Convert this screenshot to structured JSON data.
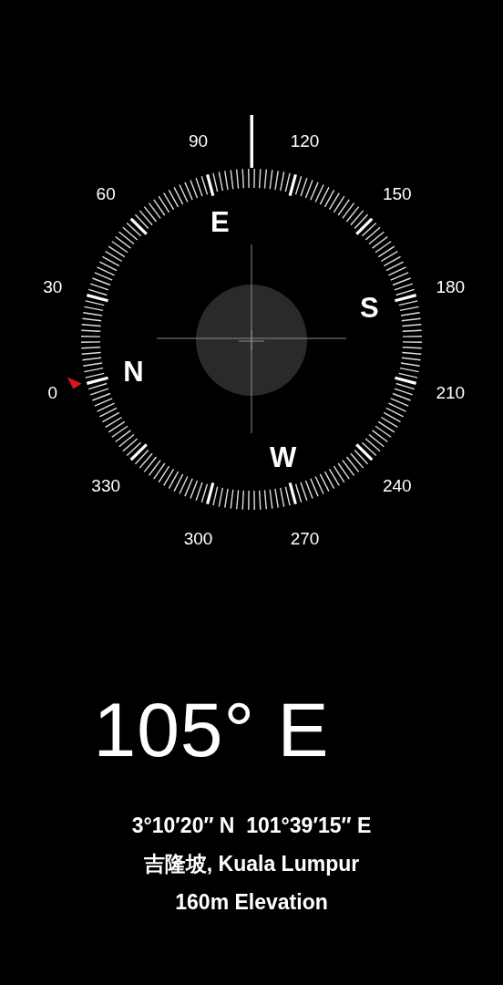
{
  "dial_labels": [
    "0",
    "30",
    "60",
    "90",
    "120",
    "150",
    "180",
    "210",
    "240",
    "270",
    "300",
    "330"
  ],
  "cardinals": [
    "N",
    "E",
    "S",
    "W"
  ],
  "heading": "105° E",
  "coordinates": "3°10′20″ N  101°39′15″ E",
  "location": "吉隆坡, Kuala Lumpur",
  "elevation": "160m Elevation"
}
